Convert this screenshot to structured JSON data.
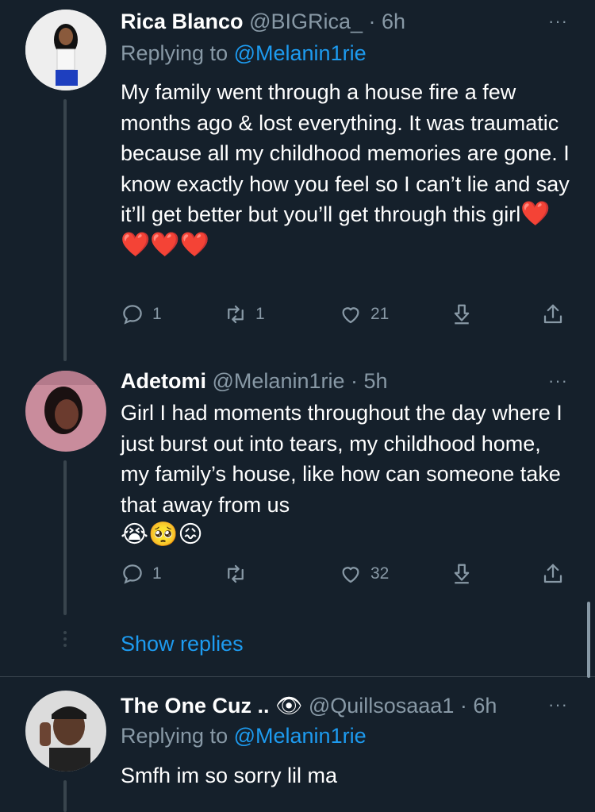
{
  "tweets": [
    {
      "name": "Rica Blanco",
      "handle": "@BIGRica_",
      "time": "· 6h",
      "replying_label": "Replying to",
      "replying_mention": "@Melanin1rie",
      "text": "My family went through a house fire a few months ago & lost everything. It was traumatic because all my childhood memories are gone. I know exactly how you feel so I can’t lie and say it’ll get better but you’ll get through this girl",
      "emojis": "❤️❤️❤️❤️",
      "replies": "1",
      "retweets": "1",
      "likes": "21"
    },
    {
      "name": "Adetomi",
      "handle": "@Melanin1rie",
      "time": "· 5h",
      "text": "Girl I had moments throughout the day where I just burst out into tears, my childhood home, my family’s house, like how can someone take that away from us",
      "emojis": "😭🥺😖",
      "replies": "1",
      "retweets": "",
      "likes": "32"
    },
    {
      "name": "The One Cuz ..",
      "name_emoji": "👁",
      "handle": "@Quillsosaaa1",
      "time": "· 6h",
      "replying_label": "Replying to",
      "replying_mention": "@Melanin1rie",
      "text": "Smfh im so sorry lil ma"
    }
  ],
  "show_replies": "Show replies",
  "more_icon": "···",
  "colors": {
    "background": "#15202b",
    "secondary_text": "#8899a6",
    "accent": "#1d9bf0",
    "heart": "#e0245e",
    "line": "#38444d"
  }
}
